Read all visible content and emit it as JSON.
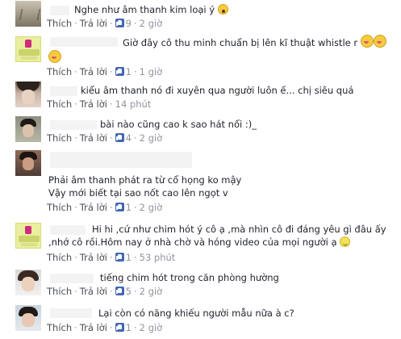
{
  "comments": [
    {
      "avatar": "landscape",
      "text": "Nghe như âm thanh kim loại ý",
      "like_label": "Thích",
      "reply_label": "Trả lời",
      "likes": "9",
      "time": "2 giờ"
    },
    {
      "avatar": "yellow-logo",
      "text": "Giờ đây cô thu minh chuẩn bị lên kĩ thuật whistle r",
      "like_label": "Thích",
      "reply_label": "Trả lời",
      "likes": "1",
      "time": "1 giờ"
    },
    {
      "avatar": "boy",
      "text": "kiểu âm thanh nó đi xuyên qua người luôn ế... chị siêu quá",
      "like_label": "Thích",
      "reply_label": "Trả lời",
      "time": "14 phút"
    },
    {
      "avatar": "boy",
      "text": "bài nào cũng cao k sao hát nổi :)_",
      "like_label": "Thích",
      "reply_label": "Trả lời",
      "likes": "4",
      "time": "2 giờ"
    },
    {
      "avatar": "boy",
      "text_lines": [
        "Phải âm thanh phát ra từ cổ họng ko mậy",
        "Vậy mới biết tại sao nốt cao lên ngọt v"
      ],
      "like_label": "Thích",
      "reply_label": "Trả lời",
      "likes": "1",
      "time": "2 giờ"
    },
    {
      "avatar": "yellow-logo",
      "text_lines": [
        "Hi hi ,cứ như chim hót ý cô ạ ,mà nhìn cô đi đáng yêu gì đâu ấy",
        ",nhớ cô rồi.Hôm nay ở nhà chờ và hóng video của mọi người ạ"
      ],
      "like_label": "Thích",
      "reply_label": "Trả lời",
      "likes": "1",
      "time": "53 phút"
    },
    {
      "avatar": "boy",
      "text": "tiếng chim hót trong căn phòng hường",
      "like_label": "Thích",
      "reply_label": "Trả lời",
      "likes": "5",
      "time": "2 giờ"
    },
    {
      "avatar": "boy",
      "text": "Lại còn có năng khiếu người mẫu nữa à c?",
      "like_label": "Thích",
      "reply_label": "Trả lời",
      "likes": "1",
      "time": "2 giờ"
    }
  ],
  "colors": {
    "link": "#4b4f56",
    "meta": "#90949c",
    "like_badge": "#4267b2"
  },
  "icons": [
    "like-badge-icon",
    "scared-emoji-icon",
    "tongue-emoji-icon",
    "smile-emoji-icon"
  ]
}
